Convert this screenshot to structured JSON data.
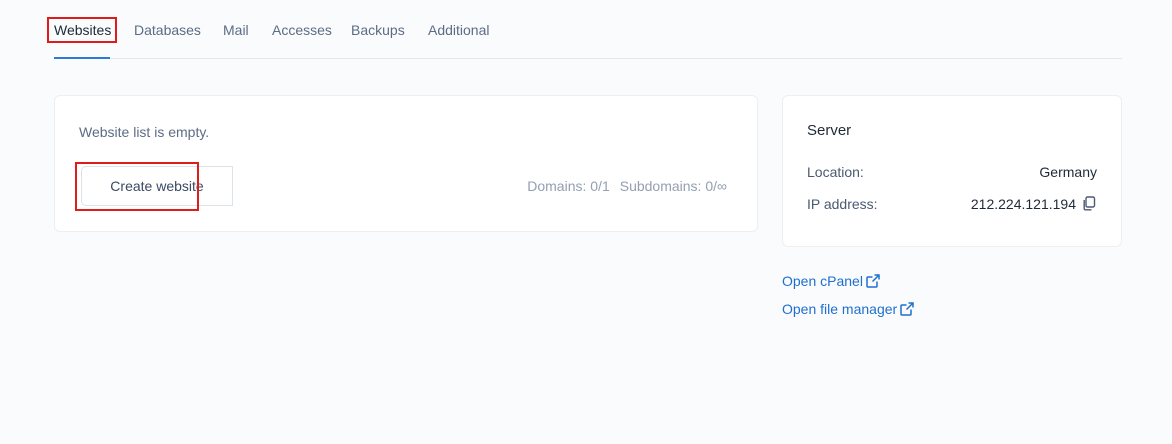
{
  "tabs": [
    {
      "label": "Websites",
      "active": true
    },
    {
      "label": "Databases"
    },
    {
      "label": "Mail"
    },
    {
      "label": "Accesses"
    },
    {
      "label": "Backups"
    },
    {
      "label": "Additional"
    }
  ],
  "websites": {
    "empty_message": "Website list is empty.",
    "create_button": "Create website",
    "dropdown_icon": "chevron-down-icon",
    "domains": "Domains: 0/1",
    "subdomains": "Subdomains: 0/∞"
  },
  "server": {
    "title": "Server",
    "location_label": "Location:",
    "location_value": "Germany",
    "ip_label": "IP address:",
    "ip_value": "212.224.121.194",
    "copy_icon": "copy-icon"
  },
  "links": {
    "cpanel": "Open cPanel",
    "file_manager": "Open file manager",
    "external_icon": "external-link-icon"
  },
  "colors": {
    "accent": "#2b7bd8",
    "link": "#1f6fcf",
    "highlight": "#e01b1b"
  }
}
